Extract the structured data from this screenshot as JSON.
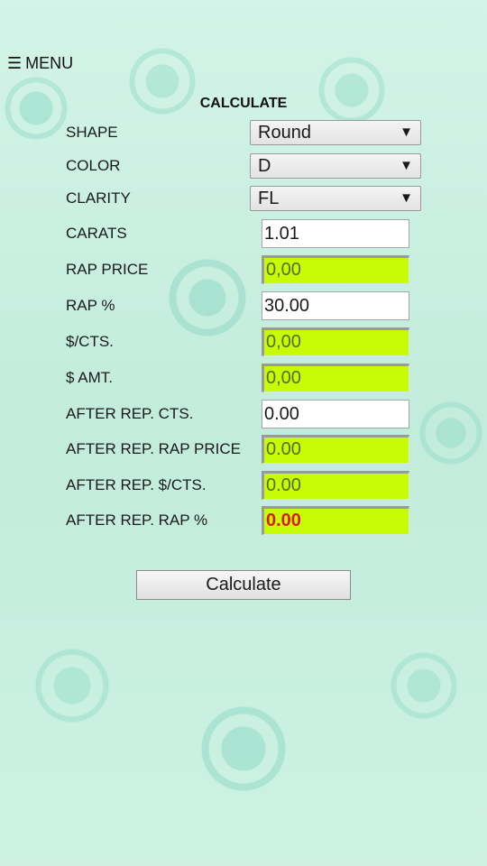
{
  "menu": {
    "icon": "☰",
    "label": "MENU"
  },
  "title": "CALCULATE",
  "fields": {
    "shape": {
      "label": "SHAPE",
      "value": "Round",
      "arrow": "▼"
    },
    "color": {
      "label": "COLOR",
      "value": "D",
      "arrow": "▼"
    },
    "clarity": {
      "label": "CLARITY",
      "value": "FL",
      "arrow": "▼"
    },
    "carats": {
      "label": "CARATS",
      "value": "1.01"
    },
    "rap_price": {
      "label": "RAP PRICE",
      "value": "0,00"
    },
    "rap_pct": {
      "label": "RAP %",
      "value": "30.00"
    },
    "per_cts": {
      "label": "$/CTS.",
      "value": "0,00"
    },
    "amount": {
      "label": "$ AMT.",
      "value": "0,00"
    },
    "after_rep_cts": {
      "label": "AFTER REP. CTS.",
      "value": "0.00"
    },
    "after_rep_rap_price": {
      "label": "AFTER REP. RAP PRICE",
      "value": "0.00"
    },
    "after_rep_per_cts": {
      "label": "AFTER REP. $/CTS.",
      "value": "0.00"
    },
    "after_rep_rap_pct": {
      "label": "AFTER REP. RAP %",
      "value": "0.00"
    }
  },
  "calculate_button": "Calculate",
  "colors": {
    "readonly_bg": "#c6fc06",
    "alert_text": "#e01a0a"
  }
}
